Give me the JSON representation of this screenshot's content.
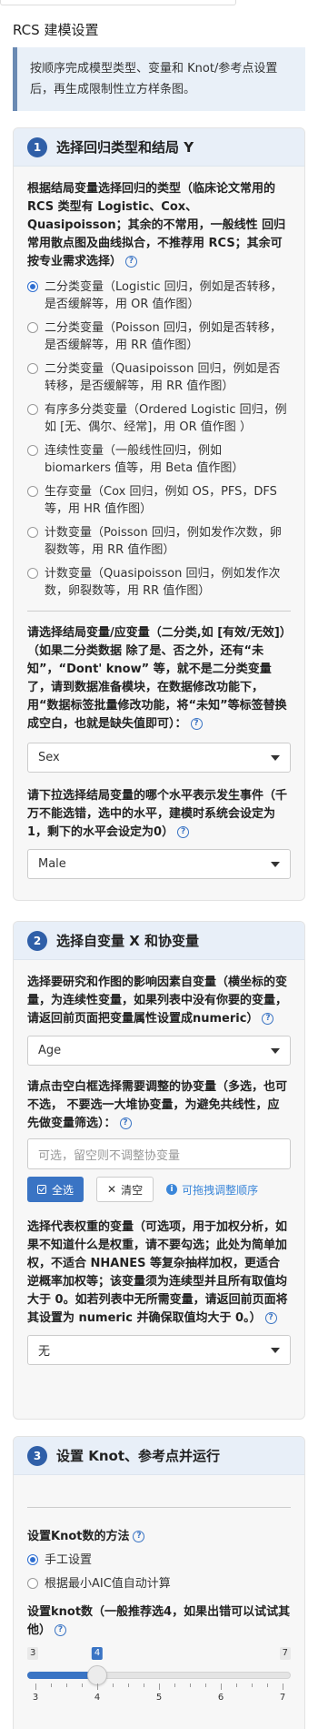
{
  "header": {
    "title": "RCS 建模设置",
    "intro": "按顺序完成模型类型、变量和 Knot/参考点设置后，再生成限制性立方样条图。"
  },
  "section1": {
    "number": "1",
    "title": "选择回归类型和结局 Y",
    "type_label": "根据结局变量选择回归的类型（临床论文常用的 RCS 类型有 Logistic、Cox、Quasipoisson；其余的不常用，一般线性 回归常用散点图及曲线拟合，不推荐用 RCS；其余可按专业需求选择）",
    "options": [
      {
        "label": "二分类变量（Logistic 回归，例如是否转移，是否缓解等，用 OR 值作图）",
        "selected": true
      },
      {
        "label": "二分类变量（Poisson 回归，例如是否转移，是否缓解等，用 RR 值作图）",
        "selected": false
      },
      {
        "label": "二分类变量（Quasipoisson 回归，例如是否转移，是否缓解等，用 RR 值作图）",
        "selected": false
      },
      {
        "label": "有序多分类变量（Ordered Logistic 回归，例如 [无、偶尔、经常]，用 OR 值作图 ）",
        "selected": false
      },
      {
        "label": "连续性变量（一般线性回归，例如 biomarkers 值等，用 Beta 值作图）",
        "selected": false
      },
      {
        "label": "生存变量（Cox 回归，例如 OS，PFS，DFS 等，用 HR 值作图）",
        "selected": false
      },
      {
        "label": "计数变量（Poisson 回归，例如发作次数，卵裂数等，用 RR 值作图）",
        "selected": false
      },
      {
        "label": "计数变量（Quasipoisson 回归，例如发作次数，卵裂数等，用 RR 值作图）",
        "selected": false
      }
    ],
    "outcome_label": "请选择结局变量/应变量（二分类,如 [有效/无效]）（如果二分类数据 除了是、否之外，还有“未知”，“Dont' know” 等，就不是二分类变量了，请到数据准备模块，在数据修改功能下，用“数据标签批量修改功能，将“未知”等标签替换成空白，也就是缺失值即可）：",
    "outcome_value": "Sex",
    "event_label": "请下拉选择结局变量的哪个水平表示发生事件（千万不能选错，选中的水平，建模时系统会设定为1，剩下的水平会设定为0）",
    "event_value": "Male"
  },
  "section2": {
    "number": "2",
    "title": "选择自变量 X 和协变量",
    "x_label": "选择要研究和作图的影响因素自变量（横坐标的变量，为连续性变量，如果列表中没有你要的变量，请返回前页面把变量属性设置成numeric）",
    "x_value": "Age",
    "cov_label": "请点击空白框选择需要调整的协变量（多选，也可不选， 不要选一大堆协变量，为避免共线性，应先做变量筛选）：",
    "cov_placeholder": "可选，留空则不调整协变量",
    "select_all": "全选",
    "clear": "清空",
    "drag_hint": "可拖拽调整顺序",
    "weight_label": "选择代表权重的变量（可选项，用于加权分析，如果不知道什么是权重，请不要勾选；此处为简单加权，不适合 NHANES 等复杂抽样加权，更适合逆概率加权等；该变量须为连续型并且所有取值均大于 0。如若列表中无所需变量，请返回前页面将其设置为 numeric 并确保取值均大于 0。）",
    "weight_value": "无"
  },
  "section3": {
    "number": "3",
    "title": "设置 Knot、参考点并运行",
    "method_label": "设置Knot数的方法",
    "methods": [
      {
        "label": "手工设置",
        "selected": true
      },
      {
        "label": "根据最小AIC值自动计算",
        "selected": false
      }
    ],
    "knot_label": "设置knot数（一般推荐选4，如果出错可以试试其他）",
    "slider": {
      "min": 3,
      "max": 7,
      "value": 4,
      "ticks": [
        "3",
        "4",
        "5",
        "6",
        "7"
      ],
      "minor_per_major": 4
    }
  },
  "colors": {
    "primary": "#3a74c4",
    "badge": "#2f5fa8",
    "intro_bg": "#e9f0f8",
    "intro_border": "#6a8ab3",
    "hint": "#3a86d9"
  },
  "icons": [
    "help-icon",
    "check-square-icon",
    "close-icon",
    "info-icon",
    "caret-down-icon"
  ]
}
